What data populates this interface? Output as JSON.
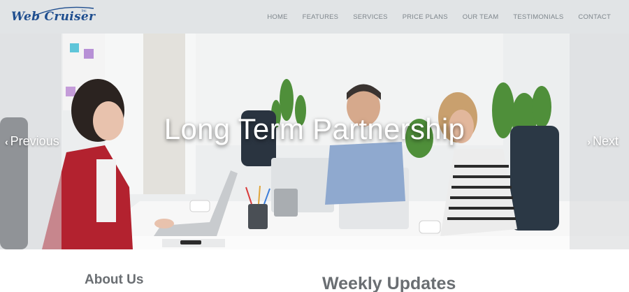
{
  "brand": {
    "logo_text": "Web Cruiser",
    "logo_mark": "Inc"
  },
  "nav": {
    "items": [
      {
        "label": "HOME"
      },
      {
        "label": "FEATURES"
      },
      {
        "label": "SERVICES"
      },
      {
        "label": "PRICE PLANS"
      },
      {
        "label": "OUR TEAM"
      },
      {
        "label": "TESTIMONIALS"
      },
      {
        "label": "CONTACT"
      }
    ]
  },
  "hero": {
    "title": "Long Term Partnership",
    "prev_label": "Previous",
    "next_label": "Next",
    "prev_icon": "chevron-left-icon",
    "next_icon": "chevron-right-icon"
  },
  "sections": {
    "about_title": "About Us",
    "weekly_title": "Weekly Updates"
  },
  "colors": {
    "header_bg": "#e1e4e6",
    "nav_text": "#7e868c",
    "logo_blue": "#1f4e8f",
    "heading_gray": "#6a6e72"
  }
}
